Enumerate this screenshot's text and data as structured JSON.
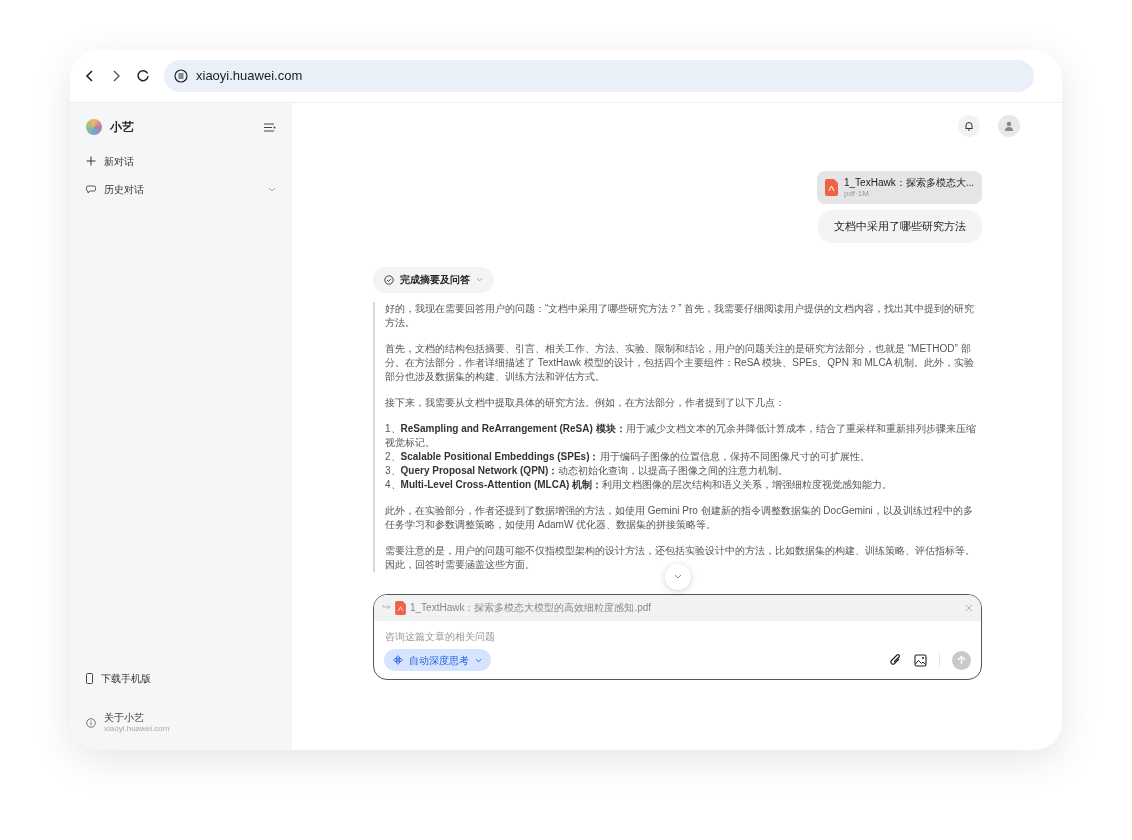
{
  "browser": {
    "url": "xiaoyi.huawei.com"
  },
  "sidebar": {
    "app_name": "小艺",
    "items": [
      {
        "label": "新对话",
        "kind": "new"
      },
      {
        "label": "历史对话",
        "kind": "history",
        "expanded": false
      }
    ],
    "footer": [
      {
        "label": "下载手机版",
        "kind": "phone"
      },
      {
        "label": "关于小艺",
        "sublabel": "xiaoyi.huawei.com",
        "kind": "info"
      }
    ]
  },
  "chat": {
    "attachment": {
      "name": "1_TexHawk：探索多模态大...",
      "meta": "pdf·1M"
    },
    "user_message": "文档中采用了哪些研究方法",
    "thinking": {
      "label": "完成摘要及问答",
      "expanded": false
    },
    "reasoning": [
      {
        "kind": "paragraph",
        "text": "好的，我现在需要回答用户的问题：“文档中采用了哪些研究方法？” 首先，我需要仔细阅读用户提供的文档内容，找出其中提到的研究方法。"
      },
      {
        "kind": "paragraph",
        "text": "首先，文档的结构包括摘要、引言、相关工作、方法、实验、限制和结论，用户的问题关注的是研究方法部分，也就是 “METHOD” 部分。在方法部分，作者详细描述了 TextHawk 模型的设计，包括四个主要组件：ReSA 模块、SPEs、QPN 和 MLCA 机制。此外，实验部分也涉及数据集的构建、训练方法和评估方式。"
      },
      {
        "kind": "paragraph",
        "text": "接下来，我需要从文档中提取具体的研究方法。例如，在方法部分，作者提到了以下几点："
      },
      {
        "kind": "list",
        "items": [
          "1、**ReSampling and ReArrangement (ReSA) 模块：**用于减少文档文本的冗余并降低计算成本，结合了重采样和重新排列步骤来压缩视觉标记。",
          "2、**Scalable Positional Embeddings (SPEs)：**用于编码子图像的位置信息，保持不同图像尺寸的可扩展性。",
          "3、**Query Proposal Network (QPN)：**动态初始化查询，以提高子图像之间的注意力机制。",
          "4、**Multi-Level Cross-Attention (MLCA) 机制：**利用文档图像的层次结构和语义关系，增强细粒度视觉感知能力。"
        ]
      },
      {
        "kind": "paragraph",
        "text": "此外，在实验部分，作者还提到了数据增强的方法，如使用 Gemini Pro 创建新的指令调整数据集的 DocGemini，以及训练过程中的多任务学习和参数调整策略，如使用 AdamW 优化器、数据集的拼接策略等。"
      },
      {
        "kind": "paragraph",
        "text": "需要注意的是，用户的问题可能不仅指模型架构的设计方法，还包括实验设计中的方法，比如数据集的构建、训练策略、评估指标等。因此，回答时需要涵盖这些方面。"
      }
    ]
  },
  "composer": {
    "attachment_name": "1_TextHawk：探索多模态大模型的高效细粒度感知.pdf",
    "placeholder": "咨询这篇文章的相关问题",
    "mode": {
      "label": "自动深度思考",
      "selected": true
    }
  }
}
